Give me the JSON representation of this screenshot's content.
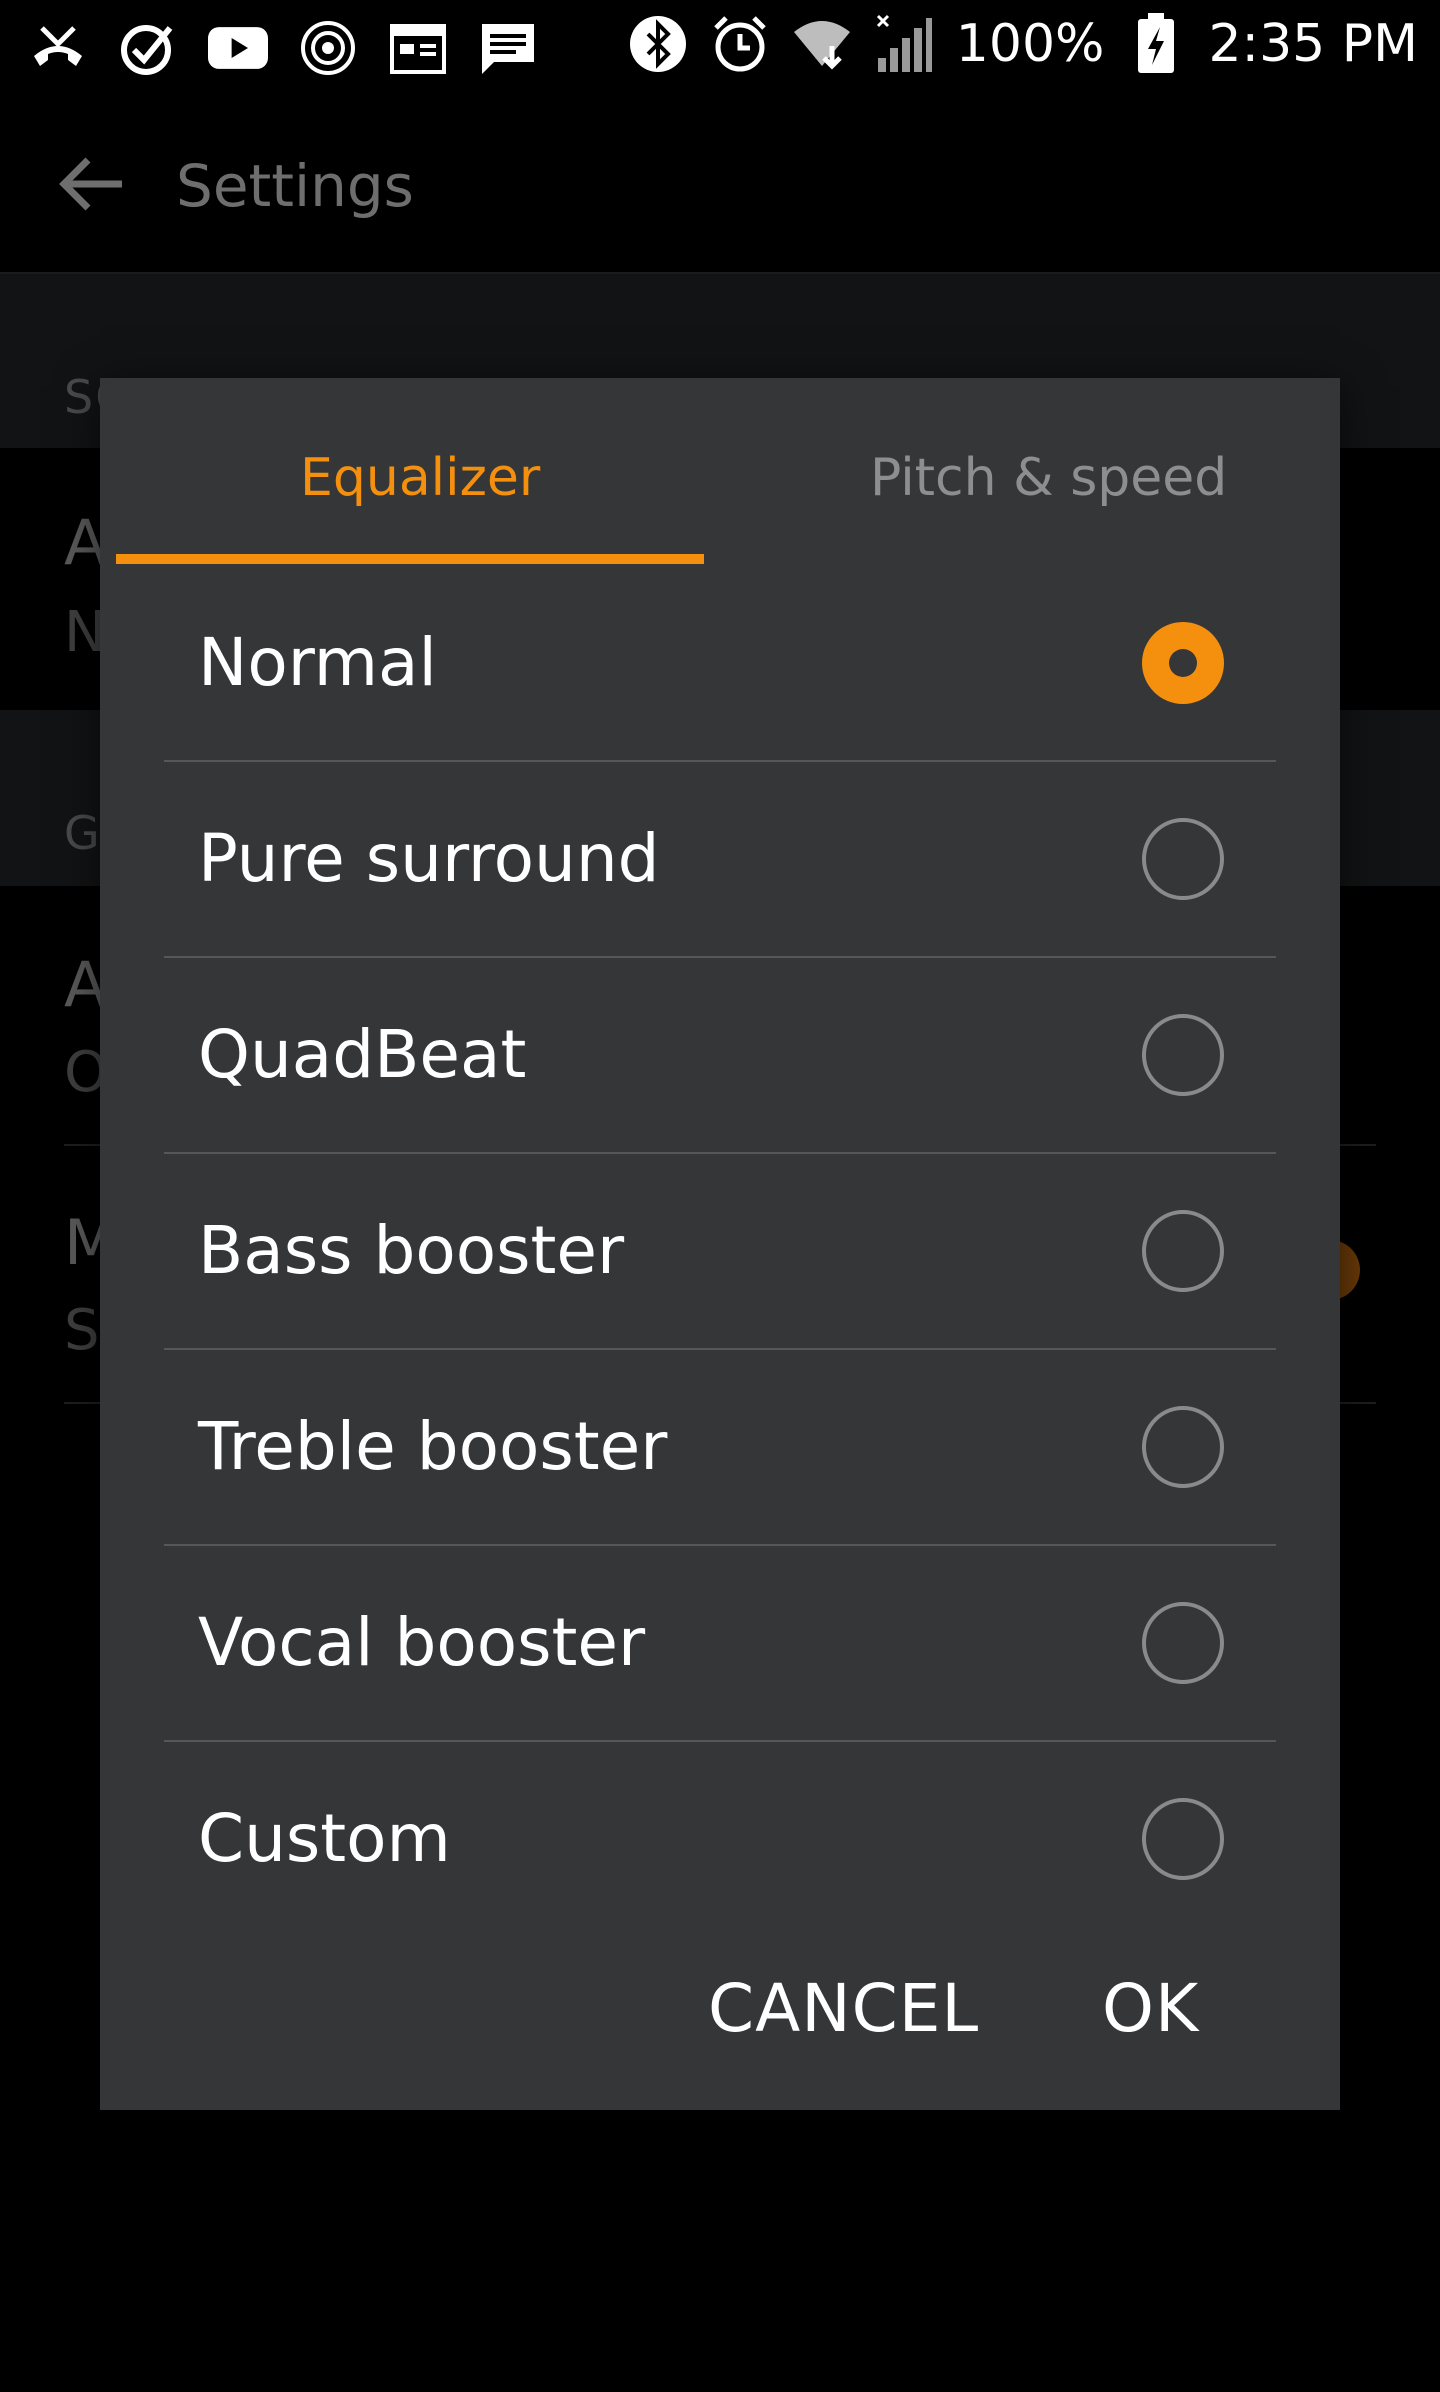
{
  "status_bar": {
    "battery": "100%",
    "time": "2:35 PM",
    "left_icons": [
      "missed-call-icon",
      "check-circle-icon",
      "youtube-icon",
      "hotspot-icon",
      "calendar-icon",
      "message-icon"
    ],
    "right_icons": [
      "bluetooth-icon",
      "alarm-icon",
      "wifi-icon",
      "cell-signal-icon",
      "battery-charging-icon"
    ]
  },
  "app_bar": {
    "title": "Settings"
  },
  "background": {
    "headers": [
      "SOUND",
      "G"
    ],
    "items": [
      {
        "title": "A",
        "subtitle": "N"
      },
      {
        "title": "A",
        "subtitle": "O"
      },
      {
        "title": "M",
        "subtitle": "S"
      }
    ]
  },
  "dialog": {
    "tabs": [
      {
        "label": "Equalizer",
        "active": true
      },
      {
        "label": "Pitch & speed",
        "active": false
      }
    ],
    "options": [
      {
        "label": "Normal",
        "selected": true
      },
      {
        "label": "Pure surround",
        "selected": false
      },
      {
        "label": "QuadBeat",
        "selected": false
      },
      {
        "label": "Bass booster",
        "selected": false
      },
      {
        "label": "Treble booster",
        "selected": false
      },
      {
        "label": "Vocal booster",
        "selected": false
      },
      {
        "label": "Custom",
        "selected": false
      }
    ],
    "cancel_label": "CANCEL",
    "ok_label": "OK"
  },
  "colors": {
    "accent": "#f5900f",
    "dialog_bg": "#353638",
    "inactive_tab": "#8e8e8e"
  }
}
